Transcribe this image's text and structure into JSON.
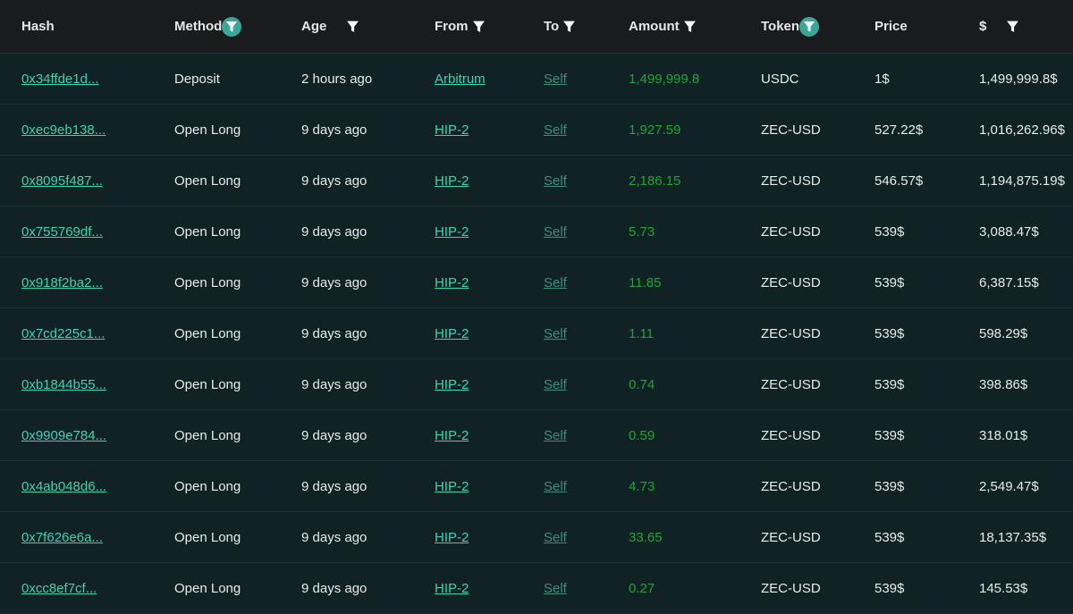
{
  "table": {
    "headers": {
      "hash": "Hash",
      "method": "Method",
      "age": "Age",
      "from": "From",
      "to": "To",
      "amount": "Amount",
      "token": "Token",
      "price": "Price",
      "usd": "$"
    },
    "rows": [
      {
        "hash": "0x34ffde1d...",
        "method": "Deposit",
        "age": "2 hours ago",
        "from": "Arbitrum",
        "to": "Self",
        "amount": "1,499,999.8",
        "token": "USDC",
        "price": "1$",
        "usd": "1,499,999.8$"
      },
      {
        "hash": "0xec9eb138...",
        "method": "Open Long",
        "age": "9 days ago",
        "from": "HIP-2",
        "to": "Self",
        "amount": "1,927.59",
        "token": "ZEC-USD",
        "price": "527.22$",
        "usd": "1,016,262.96$"
      },
      {
        "hash": "0x8095f487...",
        "method": "Open Long",
        "age": "9 days ago",
        "from": "HIP-2",
        "to": "Self",
        "amount": "2,186.15",
        "token": "ZEC-USD",
        "price": "546.57$",
        "usd": "1,194,875.19$"
      },
      {
        "hash": "0x755769df...",
        "method": "Open Long",
        "age": "9 days ago",
        "from": "HIP-2",
        "to": "Self",
        "amount": "5.73",
        "token": "ZEC-USD",
        "price": "539$",
        "usd": "3,088.47$"
      },
      {
        "hash": "0x918f2ba2...",
        "method": "Open Long",
        "age": "9 days ago",
        "from": "HIP-2",
        "to": "Self",
        "amount": "11.85",
        "token": "ZEC-USD",
        "price": "539$",
        "usd": "6,387.15$"
      },
      {
        "hash": "0x7cd225c1...",
        "method": "Open Long",
        "age": "9 days ago",
        "from": "HIP-2",
        "to": "Self",
        "amount": "1.11",
        "token": "ZEC-USD",
        "price": "539$",
        "usd": "598.29$"
      },
      {
        "hash": "0xb1844b55...",
        "method": "Open Long",
        "age": "9 days ago",
        "from": "HIP-2",
        "to": "Self",
        "amount": "0.74",
        "token": "ZEC-USD",
        "price": "539$",
        "usd": "398.86$"
      },
      {
        "hash": "0x9909e784...",
        "method": "Open Long",
        "age": "9 days ago",
        "from": "HIP-2",
        "to": "Self",
        "amount": "0.59",
        "token": "ZEC-USD",
        "price": "539$",
        "usd": "318.01$"
      },
      {
        "hash": "0x4ab048d6...",
        "method": "Open Long",
        "age": "9 days ago",
        "from": "HIP-2",
        "to": "Self",
        "amount": "4.73",
        "token": "ZEC-USD",
        "price": "539$",
        "usd": "2,549.47$"
      },
      {
        "hash": "0x7f626e6a...",
        "method": "Open Long",
        "age": "9 days ago",
        "from": "HIP-2",
        "to": "Self",
        "amount": "33.65",
        "token": "ZEC-USD",
        "price": "539$",
        "usd": "18,137.35$"
      },
      {
        "hash": "0xcc8ef7cf...",
        "method": "Open Long",
        "age": "9 days ago",
        "from": "HIP-2",
        "to": "Self",
        "amount": "0.27",
        "token": "ZEC-USD",
        "price": "539$",
        "usd": "145.53$"
      }
    ]
  },
  "icons": {
    "filter": "filter-icon",
    "filter_active": "filter-active-icon"
  },
  "colors": {
    "link": "#3fd2b4",
    "to_link": "#3e8e80",
    "amount": "#1fa535",
    "filter_active_bg": "#3aa898"
  }
}
